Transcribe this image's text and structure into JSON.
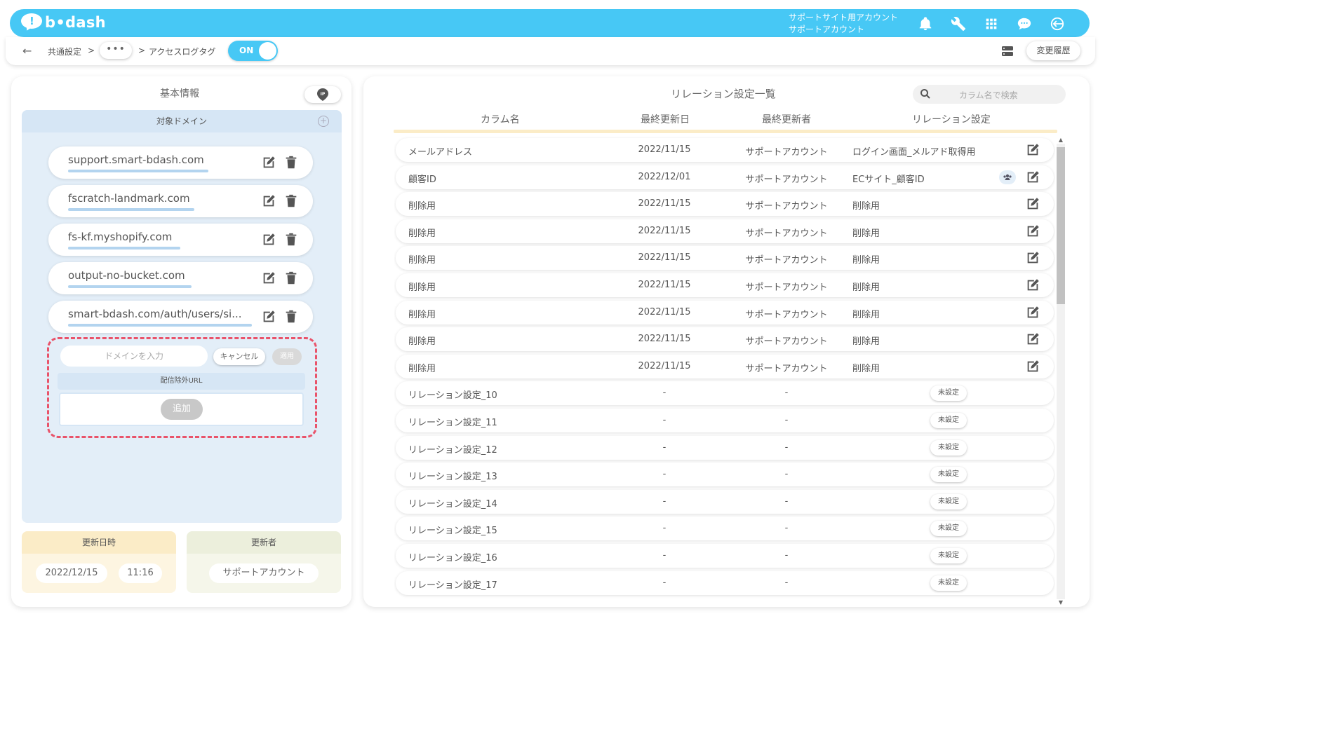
{
  "header": {
    "logo_text": "b•dash",
    "account_line1": "サポートサイト用アカウント",
    "account_line2": "サポートアカウント",
    "icons": [
      "bell-icon",
      "wrench-icon",
      "grid-icon",
      "support-chat-icon",
      "logout-icon"
    ]
  },
  "subbar": {
    "back_icon": "←",
    "crumb1": "共通設定",
    "sep1": ">",
    "more": "•••",
    "sep2": ">",
    "page": "アクセスログタグ",
    "toggle": "ON",
    "history_btn": "変更履歴",
    "db_icon": "database-icon"
  },
  "left": {
    "title": "基本情報",
    "ip_icon": "IP",
    "domain_head": "対象ドメイン",
    "plus": "+",
    "domains": [
      "support.smart-bdash.com",
      "fscratch-landmark.com",
      "fs-kf.myshopify.com",
      "output-no-bucket.com",
      "smart-bdash.com/auth/users/si..."
    ],
    "domain_input_placeholder": "ドメインを入力",
    "cancel": "キャンセル",
    "apply": "適用",
    "exclude_head": "配信除外URL",
    "add": "追加",
    "updated_head": "更新日時",
    "updated_date": "2022/12/15",
    "updated_time": "11:16",
    "updater_head": "更新者",
    "updater": "サポートアカウント"
  },
  "right": {
    "title": "リレーション設定一覧",
    "search_placeholder": "カラム名で検索",
    "columns": [
      "カラム名",
      "最終更新日",
      "最終更新者",
      "リレーション設定"
    ],
    "rows": [
      {
        "name": "メールアドレス",
        "date": "2022/11/15",
        "user": "サポートアカウント",
        "relation": "ログイン画面_メルアド取得用",
        "unset": ""
      },
      {
        "name": "顧客ID",
        "date": "2022/12/01",
        "user": "サポートアカウント",
        "relation": "ECサイト_顧客ID",
        "unset": ""
      },
      {
        "name": "削除用",
        "date": "2022/11/15",
        "user": "サポートアカウント",
        "relation": "削除用",
        "unset": ""
      },
      {
        "name": "削除用",
        "date": "2022/11/15",
        "user": "サポートアカウント",
        "relation": "削除用",
        "unset": ""
      },
      {
        "name": "削除用",
        "date": "2022/11/15",
        "user": "サポートアカウント",
        "relation": "削除用",
        "unset": ""
      },
      {
        "name": "削除用",
        "date": "2022/11/15",
        "user": "サポートアカウント",
        "relation": "削除用",
        "unset": ""
      },
      {
        "name": "削除用",
        "date": "2022/11/15",
        "user": "サポートアカウント",
        "relation": "削除用",
        "unset": ""
      },
      {
        "name": "削除用",
        "date": "2022/11/15",
        "user": "サポートアカウント",
        "relation": "削除用",
        "unset": ""
      },
      {
        "name": "削除用",
        "date": "2022/11/15",
        "user": "サポートアカウント",
        "relation": "削除用",
        "unset": ""
      },
      {
        "name": "リレーション設定_10",
        "date": "-",
        "user": "-",
        "relation": "",
        "unset": "未設定"
      },
      {
        "name": "リレーション設定_11",
        "date": "-",
        "user": "-",
        "relation": "",
        "unset": "未設定"
      },
      {
        "name": "リレーション設定_12",
        "date": "-",
        "user": "-",
        "relation": "",
        "unset": "未設定"
      },
      {
        "name": "リレーション設定_13",
        "date": "-",
        "user": "-",
        "relation": "",
        "unset": "未設定"
      },
      {
        "name": "リレーション設定_14",
        "date": "-",
        "user": "-",
        "relation": "",
        "unset": "未設定"
      },
      {
        "name": "リレーション設定_15",
        "date": "-",
        "user": "-",
        "relation": "",
        "unset": "未設定"
      },
      {
        "name": "リレーション設定_16",
        "date": "-",
        "user": "-",
        "relation": "",
        "unset": "未設定"
      },
      {
        "name": "リレーション設定_17",
        "date": "-",
        "user": "-",
        "relation": "",
        "unset": "未設定"
      }
    ]
  },
  "colors": {
    "brand": "#47c8f5",
    "left_accent": "#d9ecf9",
    "right_accent": "#fbecc7",
    "danger_dash": "#e9536a"
  }
}
